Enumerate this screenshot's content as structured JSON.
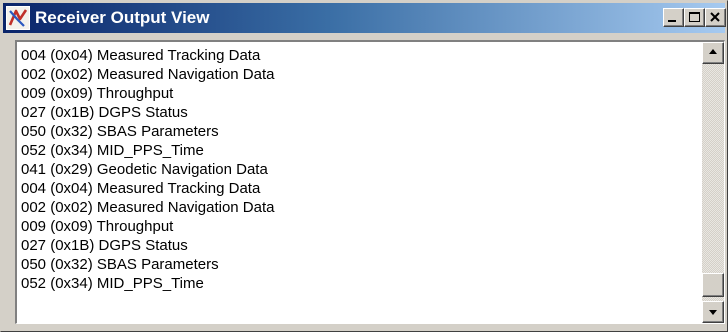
{
  "window": {
    "title": "Receiver Output View",
    "icon": "receiver-app-icon",
    "titlebar_color_start": "#0a246a",
    "titlebar_color_end": "#a6caf0"
  },
  "controls": {
    "minimize_icon": "minimize-icon",
    "maximize_icon": "maximize-icon",
    "close_icon": "close-icon"
  },
  "messages": [
    "004 (0x04) Measured Tracking Data",
    "002 (0x02) Measured Navigation Data",
    "009 (0x09) Throughput",
    "027 (0x1B) DGPS Status",
    "050 (0x32) SBAS Parameters",
    "052 (0x34) MID_PPS_Time",
    "041 (0x29) Geodetic Navigation Data",
    "004 (0x04) Measured Tracking Data",
    "002 (0x02) Measured Navigation Data",
    "009 (0x09) Throughput",
    "027 (0x1B) DGPS Status",
    "050 (0x32) SBAS Parameters",
    "052 (0x34) MID_PPS_Time"
  ],
  "scrollbar": {
    "position_fraction": 0.98,
    "up_icon": "scroll-up-arrow-icon",
    "down_icon": "scroll-down-arrow-icon"
  }
}
